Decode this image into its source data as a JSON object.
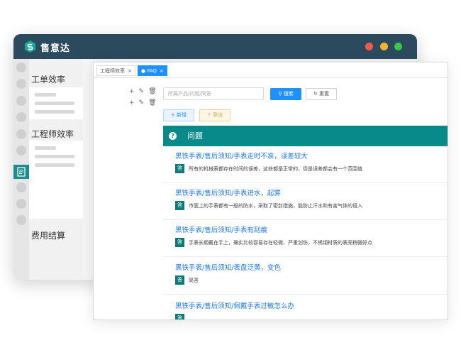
{
  "app": {
    "brand": "售意达",
    "colors": {
      "titlebar": "#2c4a5e",
      "accent": "#098a8a",
      "link": "#1e78e6",
      "primary": "#1e90ff"
    }
  },
  "back_sidebar": {
    "sections": [
      {
        "title": "工单效率"
      },
      {
        "title": "工程师效率"
      },
      {
        "title": "费用结算"
      }
    ]
  },
  "tabs": [
    {
      "label": "工程师效率",
      "close": "×",
      "active": false
    },
    {
      "label": "FAQ",
      "close": "×",
      "active": true
    }
  ],
  "toolbar": {
    "search_placeholder": "所属产品/问题/简答",
    "search_label": "搜索",
    "reset_label": "重置",
    "add_label": "+ 新增",
    "export_label": "导出"
  },
  "section": {
    "title": "问题",
    "icon": "question-circle-icon"
  },
  "faq": [
    {
      "question": "黑铁手表/售后须知/手表走时不准，误差较大",
      "badge": "答",
      "answer": "所有的机械表都存在时间的误差，这些都是正常的，但是误差都会有一个范围值"
    },
    {
      "question": "黑铁手表/售后须知/手表进水，起雾",
      "badge": "答",
      "answer": "市面上的手表都有一般的防水，采取了密封措施，能防止汗水和有害气体的侵入"
    },
    {
      "question": "黑铁手表/售后须知/手表有刮痕",
      "badge": "答",
      "answer": "手表长期戴在手上，确实比较容易存在轻微、严重划伤，不锈钢材质的表壳稍微好点"
    },
    {
      "question": "黑铁手表/售后须知/表盘泛黄，变色",
      "badge": "答",
      "answer": "简答"
    },
    {
      "question": "黑铁手表/售后须知/佩戴手表过敏怎么办",
      "badge": "答",
      "answer": ""
    }
  ]
}
